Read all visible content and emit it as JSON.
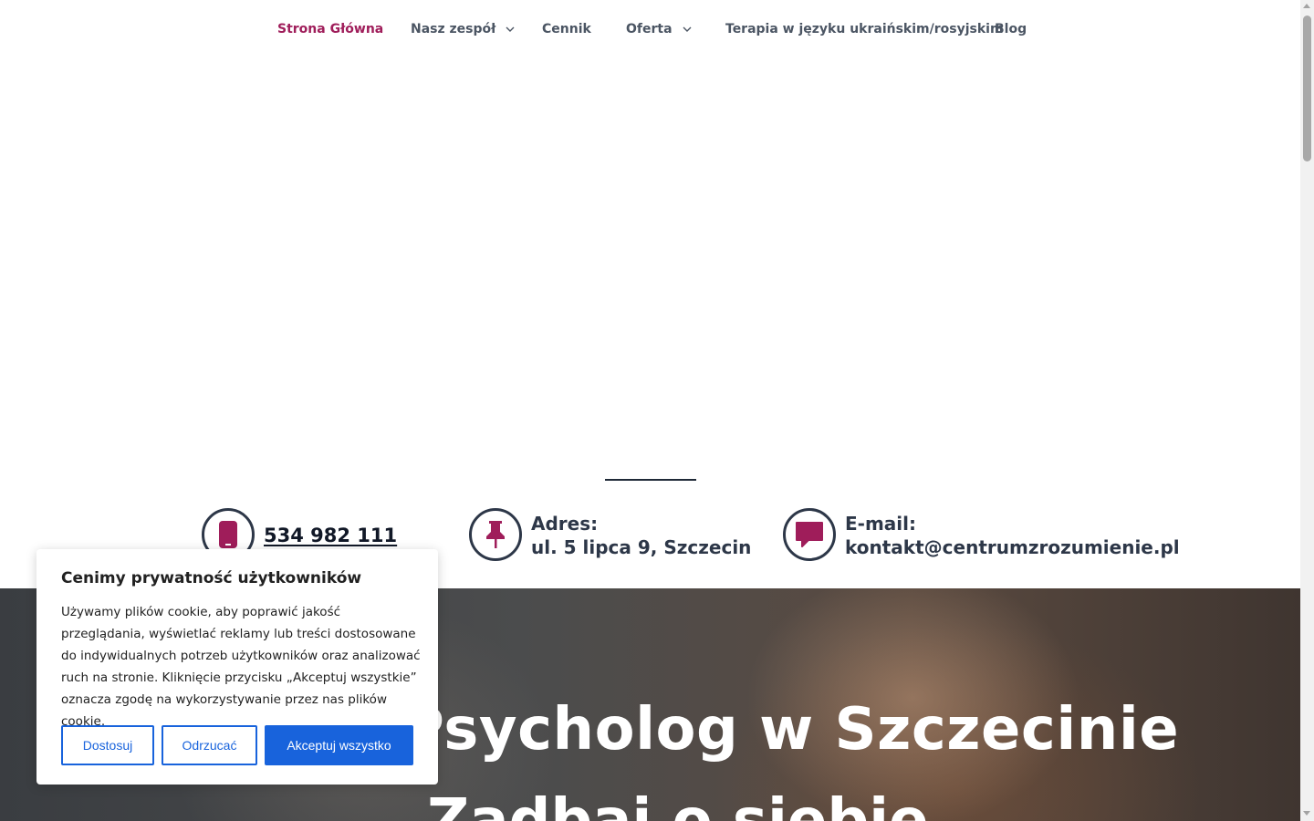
{
  "nav": {
    "items": [
      {
        "label": "Strona Główna",
        "active": true
      },
      {
        "label": "Nasz zespół",
        "dropdown": true
      },
      {
        "label": "Cennik"
      },
      {
        "label": "Oferta",
        "dropdown": true
      },
      {
        "label": "Terapia w języku ukraińskim/rosyjskim"
      },
      {
        "label": "Blog"
      }
    ]
  },
  "contact": {
    "phone": {
      "icon": "phone-icon",
      "value": "534 982 111"
    },
    "address": {
      "icon": "pushpin-icon",
      "label": "Adres:",
      "value": "ul. 5 lipca 9, Szczecin"
    },
    "email": {
      "icon": "speech-bubble-icon",
      "label": "E-mail:",
      "value": "kontakt@centrumzrozumienie.pl"
    }
  },
  "hero": {
    "title": "Psycholog w Szczecinie",
    "subtitle": "Zadbaj o siebie"
  },
  "cookie": {
    "title": "Cenimy prywatność użytkowników",
    "body": "Używamy plików cookie, aby poprawić jakość przeglądania, wyświetlać reklamy lub treści dostosowane do indywidualnych potrzeb użytkowników oraz analizować ruch na stronie. Kliknięcie przycisku „Akceptuj wszystkie” oznacza zgodę na wykorzystywanie przez nas plików cookie.",
    "customize_label": "Dostosuj",
    "reject_label": "Odrzucać",
    "accept_label": "Akceptuj wszystko"
  },
  "colors": {
    "accent": "#9f1d5a",
    "dark": "#2d3748",
    "button_blue": "#1863dc"
  }
}
